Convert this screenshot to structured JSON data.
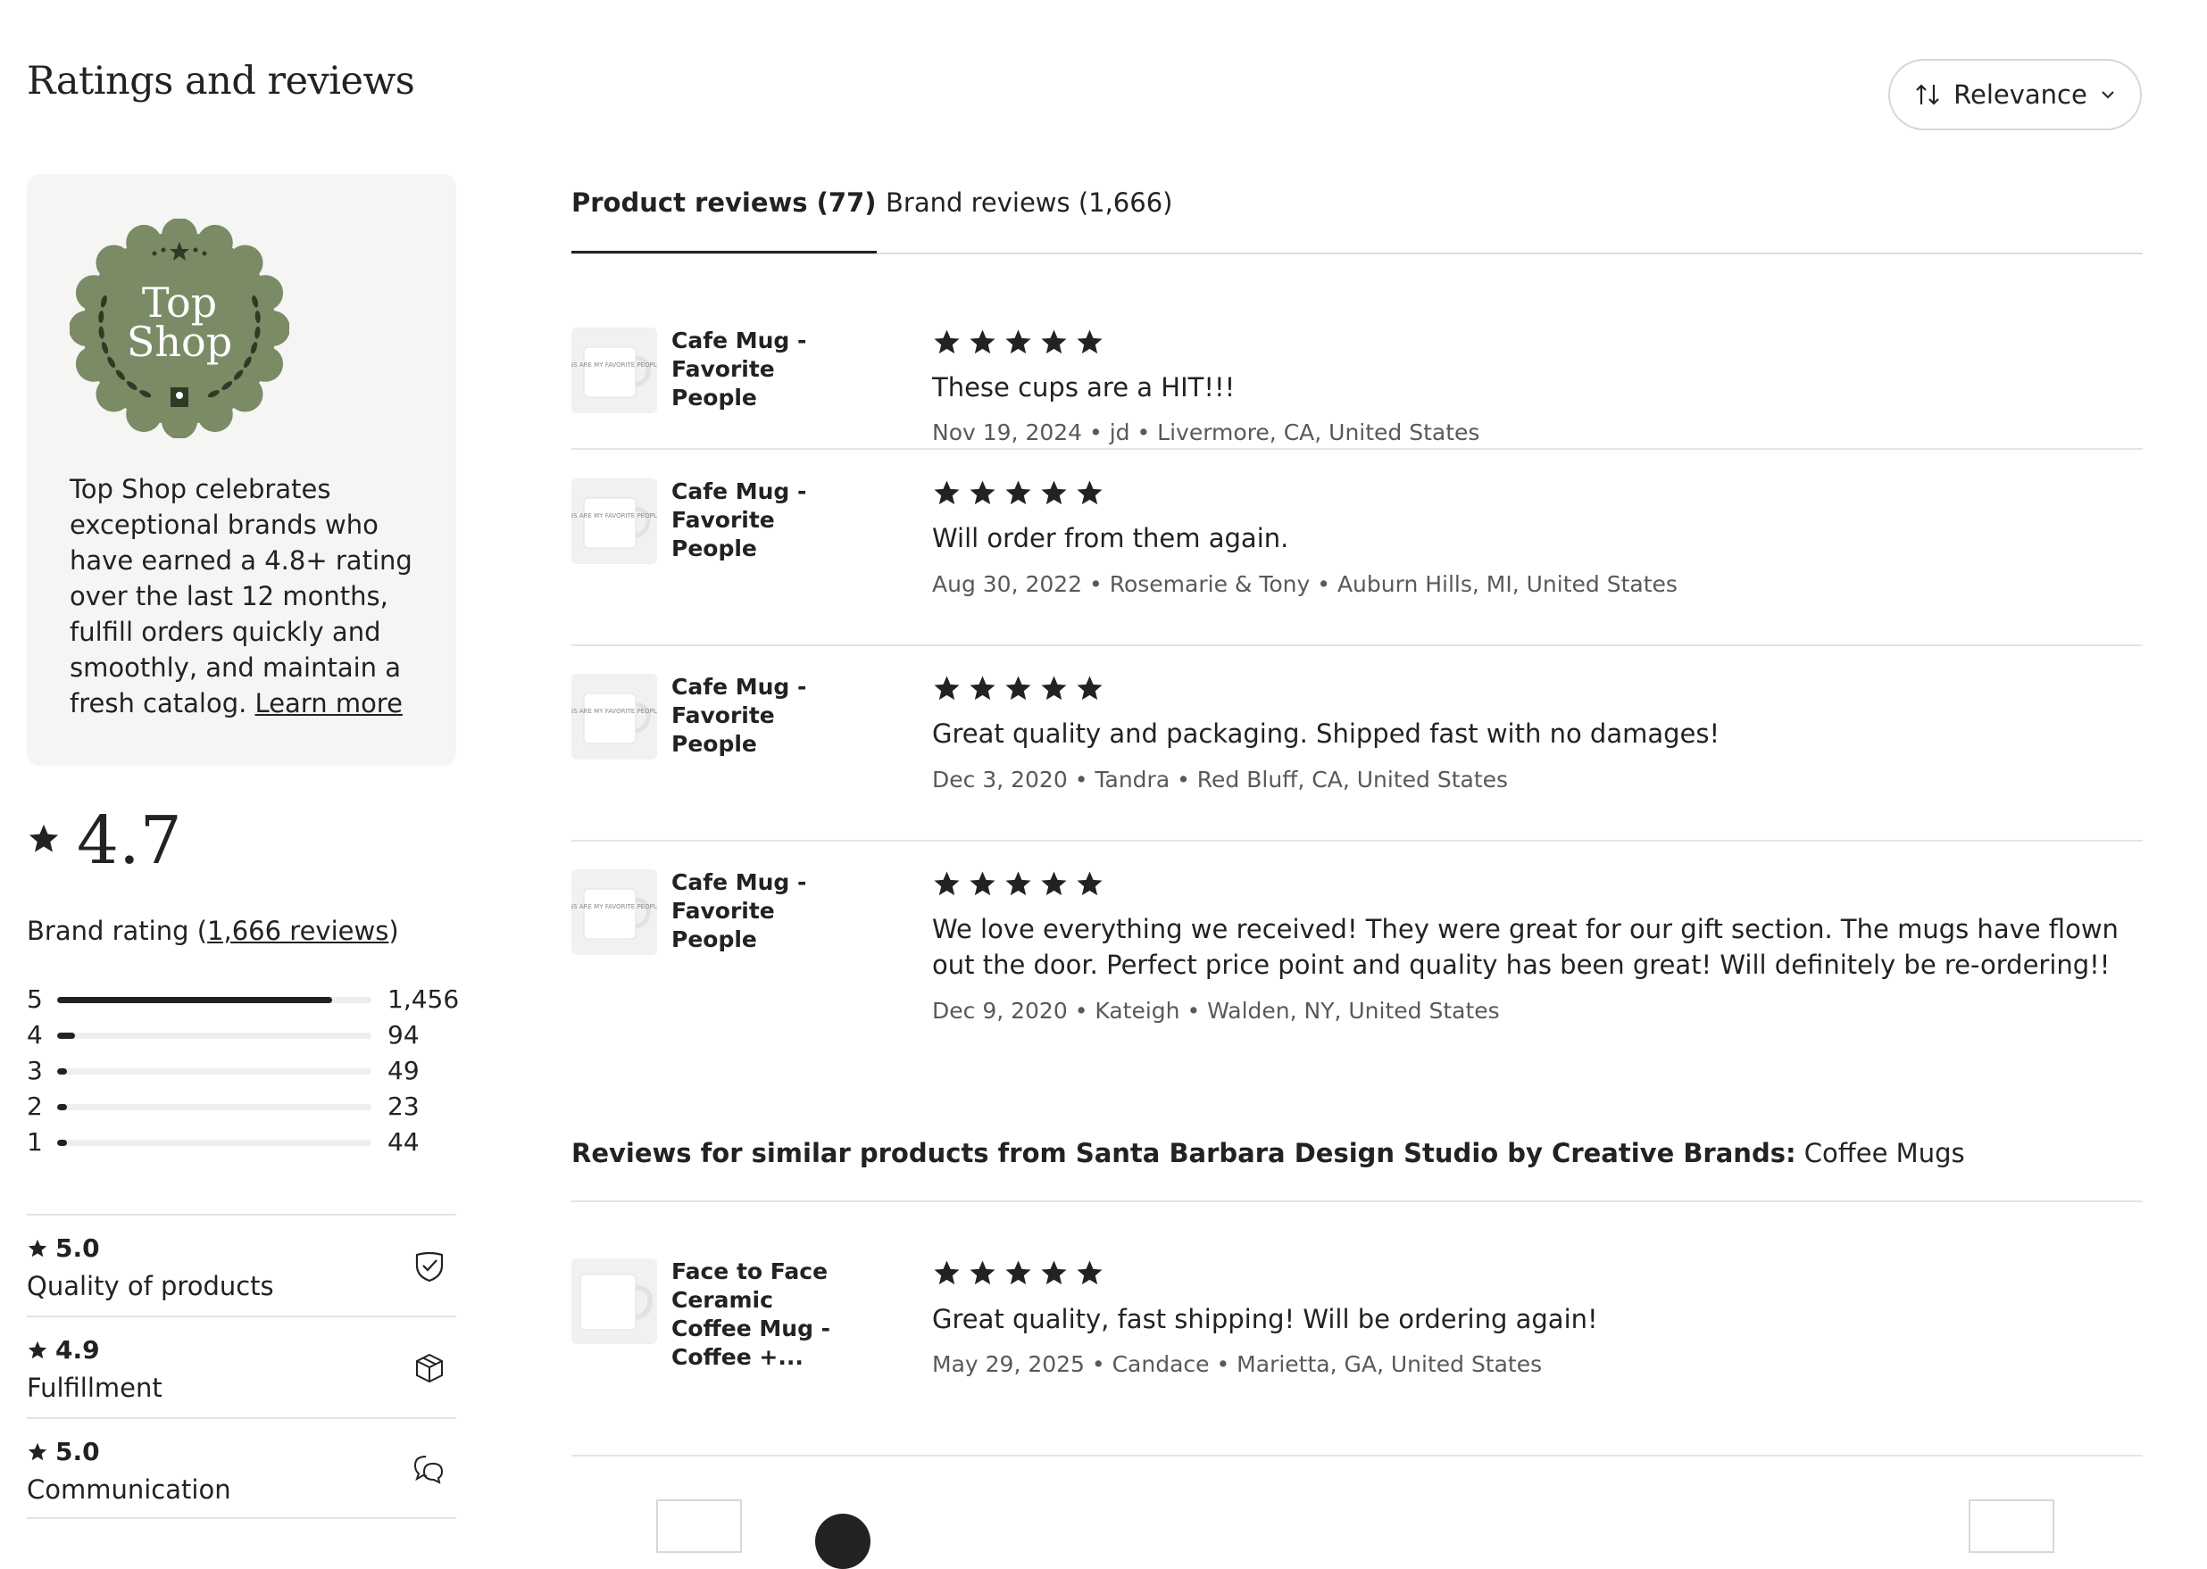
{
  "header": {
    "title": "Ratings and reviews",
    "sort_label": "Relevance"
  },
  "badge": {
    "line1": "Top",
    "line2": "Shop",
    "description": "Top Shop celebrates exceptional brands who have earned a 4.8+ rating over the last 12 months, fulfill orders quickly and smoothly, and maintain a fresh catalog.",
    "learn_more": "Learn more",
    "color": "#7a8b65"
  },
  "brand_rating": {
    "value": "4.7",
    "label_prefix": "Brand rating (",
    "reviews_link": "1,666 reviews",
    "label_suffix": ")"
  },
  "distribution": [
    {
      "stars": "5",
      "count": "1,456",
      "fraction": 0.874
    },
    {
      "stars": "4",
      "count": "94",
      "fraction": 0.056
    },
    {
      "stars": "3",
      "count": "49",
      "fraction": 0.029
    },
    {
      "stars": "2",
      "count": "23",
      "fraction": 0.014
    },
    {
      "stars": "1",
      "count": "44",
      "fraction": 0.026
    }
  ],
  "metrics": [
    {
      "score": "5.0",
      "label": "Quality of products",
      "icon": "shield-check-icon"
    },
    {
      "score": "4.9",
      "label": "Fulfillment",
      "icon": "box-icon"
    },
    {
      "score": "5.0",
      "label": "Communication",
      "icon": "chat-bubbles-icon"
    }
  ],
  "tabs": {
    "product": "Product reviews (77)",
    "brand": "Brand reviews (1,666)"
  },
  "reviews": [
    {
      "product": "Cafe Mug - Favorite People",
      "mug_text": "DOGS ARE MY FAVORITE PEOPLE",
      "rating": 5,
      "text": "These cups are a HIT!!!",
      "meta": "Nov 19, 2024 • jd • Livermore, CA, United States"
    },
    {
      "product": "Cafe Mug - Favorite People",
      "mug_text": "DOGS ARE MY FAVORITE PEOPLE",
      "rating": 5,
      "text": "Will order from them again.",
      "meta": "Aug 30, 2022 • Rosemarie & Tony • Auburn Hills, MI, United States"
    },
    {
      "product": "Cafe Mug - Favorite People",
      "mug_text": "DOGS ARE MY FAVORITE PEOPLE",
      "rating": 5,
      "text": "Great quality and packaging. Shipped fast with no damages!",
      "meta": "Dec 3, 2020 • Tandra • Red Bluff, CA, United States"
    },
    {
      "product": "Cafe Mug - Favorite People",
      "mug_text": "DOGS ARE MY FAVORITE PEOPLE",
      "rating": 5,
      "text": "We love everything we received! They were great for our gift section. The mugs have flown out the door. Perfect price point and quality has been great! Will definitely be re-ordering!!",
      "meta": "Dec 9, 2020 • Kateigh • Walden, NY, United States"
    }
  ],
  "similar": {
    "heading_bold": "Reviews for similar products from Santa Barbara Design Studio by Creative Brands:",
    "heading_category": "Coffee Mugs",
    "reviews": [
      {
        "product": "Face to Face Ceramic Coffee Mug - Coffee +...",
        "rating": 5,
        "text": "Great quality, fast shipping! Will be ordering again!",
        "meta": "May 29, 2025 • Candace • Marietta, GA, United States"
      }
    ]
  }
}
